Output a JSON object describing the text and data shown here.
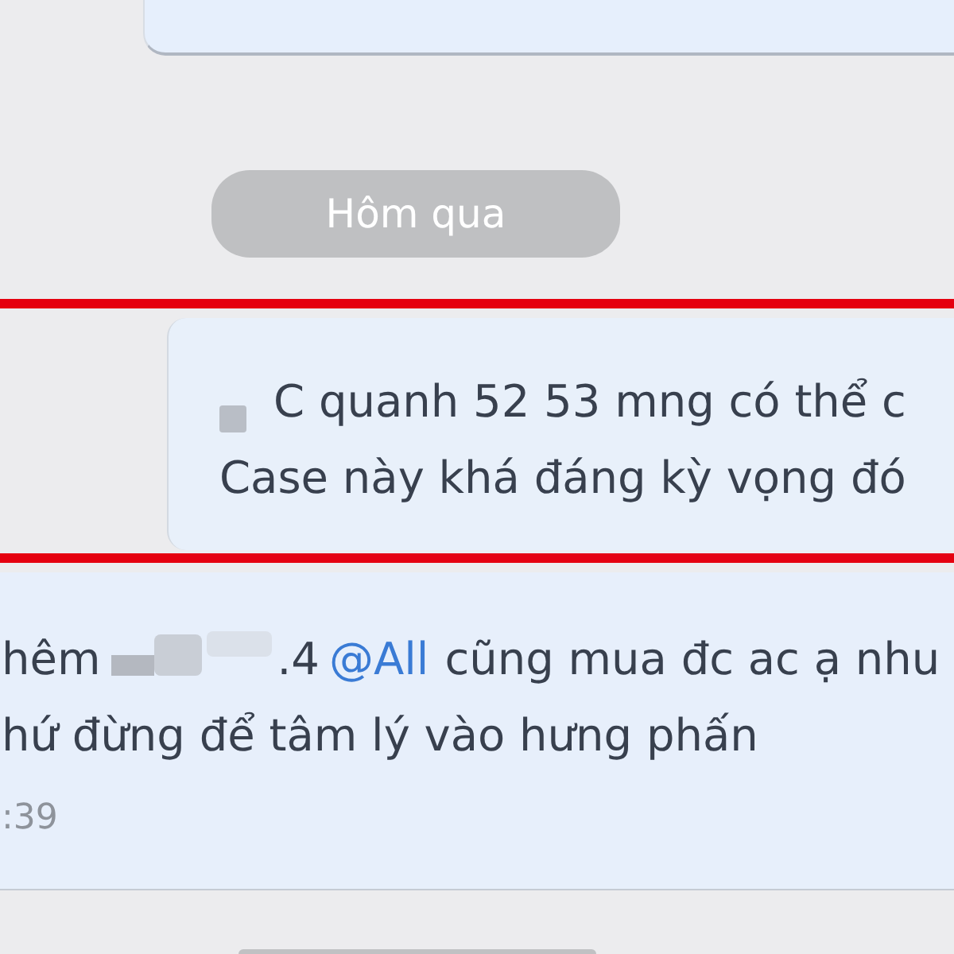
{
  "date_divider": {
    "label": "Hôm qua"
  },
  "messages": [
    {
      "highlighted": true,
      "lines": [
        [
          {
            "kind": "masked"
          },
          {
            "kind": "text",
            "text": "C quanh 52 53 mng có thể c"
          }
        ],
        [
          {
            "kind": "text",
            "text": "Case này khá đáng kỳ vọng đó"
          }
        ]
      ]
    },
    {
      "highlighted": false,
      "lines": [
        [
          {
            "kind": "text",
            "text": "hêm"
          },
          {
            "kind": "blurred"
          },
          {
            "kind": "text",
            "text": ".4"
          },
          {
            "kind": "mention",
            "text": "@All"
          },
          {
            "kind": "text",
            "text": "cũng mua đc ac ạ nhu"
          }
        ],
        [
          {
            "kind": "text",
            "text": "hứ đừng để tâm lý vào hưng phấn"
          }
        ]
      ],
      "time": ":39"
    }
  ]
}
